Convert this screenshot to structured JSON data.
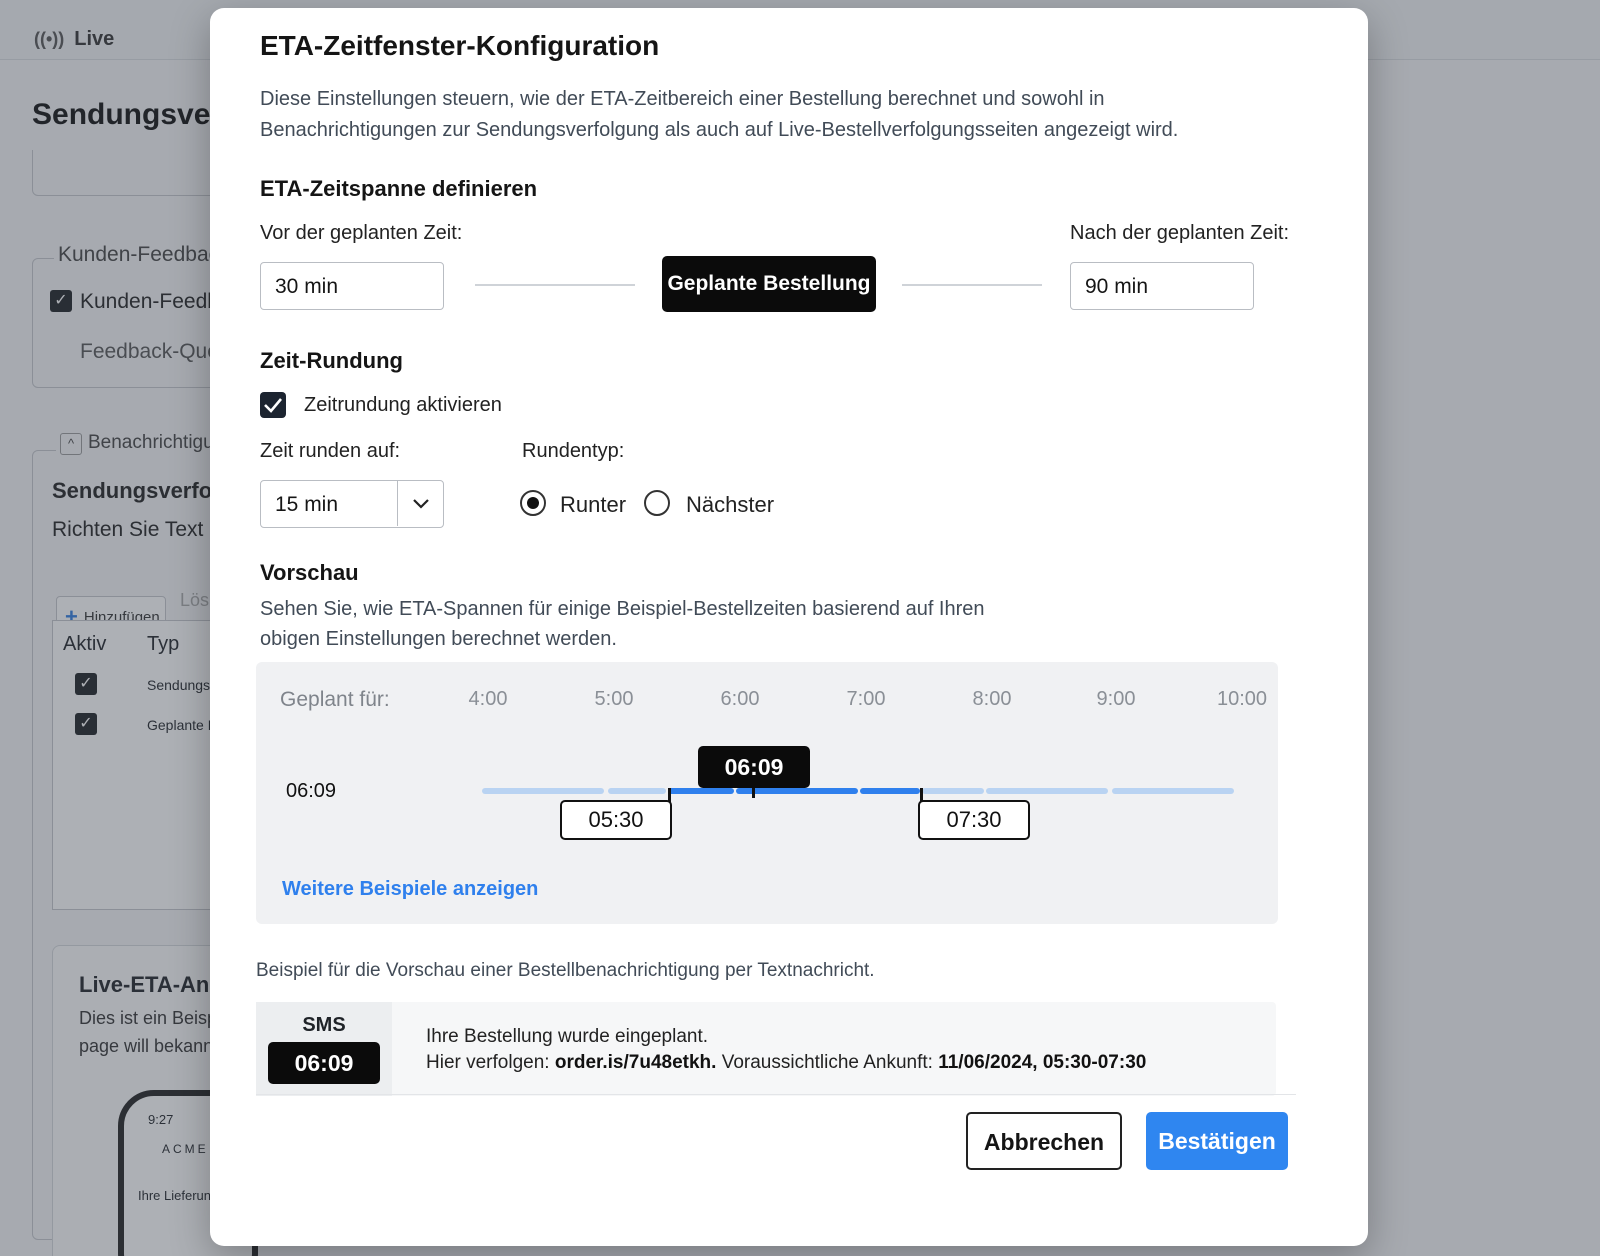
{
  "background": {
    "live_label": "Live",
    "page_title": "Sendungsverfol",
    "feedback_legend": "Kunden-Feedback",
    "feedback_checkbox_label": "Kunden-Feedba",
    "feedback_quelle": "Feedback-Que",
    "notifications_legend": "Benachrichtigung",
    "section_title": "Sendungsverfolg",
    "section_desc": "Richten Sie Text e",
    "add_button": "Hinzufügen",
    "delete_button": "Lös",
    "table_headers": [
      "Aktiv",
      "Typ"
    ],
    "table_rows": [
      "Sendungsve",
      "Geplante Be"
    ],
    "live_eta_title": "Live-ETA-Anzei",
    "live_eta_desc_1": "Dies ist ein Beispi",
    "live_eta_desc_2": "page will bekanni",
    "phone_time": "9:27",
    "phone_brand": "ACME",
    "phone_text": "Ihre Lieferun"
  },
  "modal": {
    "title": "ETA-Zeitfenster-Konfiguration",
    "description": "Diese Einstellungen steuern, wie der ETA-Zeitbereich einer Bestellung berechnet und sowohl in Benachrichtigungen zur Sendungsverfolgung als auch auf Live-Bestellverfolgungsseiten angezeigt wird.",
    "span_section": {
      "heading": "ETA-Zeitspanne definieren",
      "before_label": "Vor der geplanten Zeit:",
      "before_value": "30 min",
      "center_label": "Geplante Bestellung",
      "after_label": "Nach der geplanten Zeit:",
      "after_value": "90 min"
    },
    "rounding": {
      "heading": "Zeit-Rundung",
      "enable_label": "Zeitrundung aktivieren",
      "enabled": true,
      "round_to_label": "Zeit runden auf:",
      "round_to_value": "15 min",
      "type_label": "Rundentyp:",
      "options": [
        "Runter",
        "Nächster"
      ],
      "selected": "Runter"
    },
    "preview": {
      "heading": "Vorschau",
      "description_1": "Sehen Sie, wie ETA-Spannen für einige Beispiel-Bestellzeiten basierend auf Ihren",
      "description_2": "obigen Einstellungen berechnet werden.",
      "row_label": "Geplant für:",
      "ticks": [
        "4:00",
        "5:00",
        "6:00",
        "7:00",
        "8:00",
        "9:00",
        "10:00"
      ],
      "example_time": "06:09",
      "scheduled_marker": "06:09",
      "eta_start": "05:30",
      "eta_end": "07:30",
      "more_link": "Weitere Beispiele anzeigen"
    },
    "sms_preview": {
      "caption": "Beispiel für die Vorschau einer Bestellbenachrichtigung per Textnachricht.",
      "channel": "SMS",
      "time": "06:09",
      "line1": "Ihre Bestellung wurde eingeplant.",
      "line2_prefix": "Hier verfolgen: ",
      "line2_link": "order.is/7u48etkh.",
      "line2_mid": " Voraussichtliche Ankunft: ",
      "line2_eta": "11/06/2024, 05:30-07:30"
    },
    "buttons": {
      "cancel": "Abbrechen",
      "confirm": "Bestätigen"
    }
  },
  "colors": {
    "accent": "#2f86f0",
    "bar_active": "#2f80ed",
    "bar_inactive": "#b9d3f2"
  }
}
